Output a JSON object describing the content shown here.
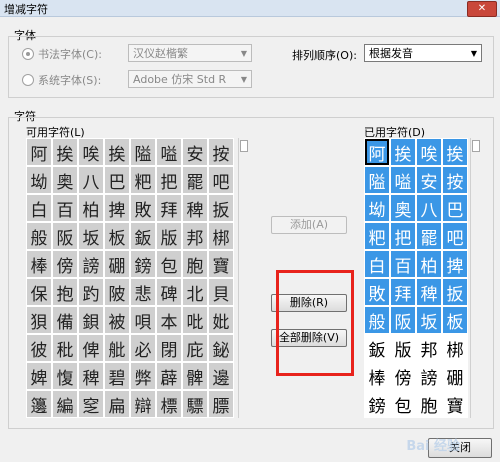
{
  "window": {
    "title": "增减字符",
    "close_glyph": "✕"
  },
  "font_group": {
    "label": "字体",
    "calligraphy": {
      "label": "书法字体(C):",
      "value": "汉仪赵楷繁"
    },
    "system": {
      "label": "系统字体(S):",
      "value": "Adobe 仿宋 Std R"
    },
    "sort": {
      "label": "排列顺序(O):",
      "value": "根据发音"
    }
  },
  "chars_group": {
    "label": "字符",
    "available_label": "可用字符(L)",
    "used_label": "已用字符(D)",
    "available_rows": [
      [
        "阿",
        "挨",
        "唉",
        "挨",
        "隘",
        "嗌",
        "安",
        "按"
      ],
      [
        "坳",
        "奥",
        "八",
        "巴",
        "粑",
        "把",
        "罷",
        "吧"
      ],
      [
        "白",
        "百",
        "柏",
        "捭",
        "敗",
        "拜",
        "稗",
        "扳"
      ],
      [
        "般",
        "阪",
        "坂",
        "板",
        "鈑",
        "版",
        "邦",
        "梆"
      ],
      [
        "棒",
        "傍",
        "謗",
        "硼",
        "鎊",
        "包",
        "胞",
        "寶"
      ],
      [
        "保",
        "抱",
        "趵",
        "陂",
        "悲",
        "碑",
        "北",
        "貝"
      ],
      [
        "狽",
        "備",
        "鋇",
        "被",
        "唄",
        "本",
        "吡",
        "妣"
      ],
      [
        "彼",
        "秕",
        "俾",
        "舭",
        "必",
        "閉",
        "庇",
        "鉍"
      ],
      [
        "婢",
        "愎",
        "稗",
        "碧",
        "弊",
        "薜",
        "髀",
        "邊"
      ],
      [
        "籩",
        "編",
        "窆",
        "扁",
        "辯",
        "標",
        "驃",
        "膘"
      ]
    ],
    "used_rows": [
      [
        "阿",
        "挨",
        "唉",
        "挨"
      ],
      [
        "隘",
        "嗌",
        "安",
        "按"
      ],
      [
        "坳",
        "奥",
        "八",
        "巴"
      ],
      [
        "粑",
        "把",
        "罷",
        "吧"
      ],
      [
        "白",
        "百",
        "柏",
        "捭"
      ],
      [
        "敗",
        "拜",
        "稗",
        "扳"
      ],
      [
        "般",
        "阪",
        "坂",
        "板"
      ],
      [
        "鈑",
        "版",
        "邦",
        "梆"
      ],
      [
        "棒",
        "傍",
        "謗",
        "硼"
      ],
      [
        "鎊",
        "包",
        "胞",
        "寶"
      ]
    ],
    "used_selected_rows": 7,
    "add_label": "添加(A)",
    "remove_label": "删除(R)",
    "remove_all_label": "全部删除(V)"
  },
  "close_label": "关闭",
  "watermark": "Bai 经验"
}
